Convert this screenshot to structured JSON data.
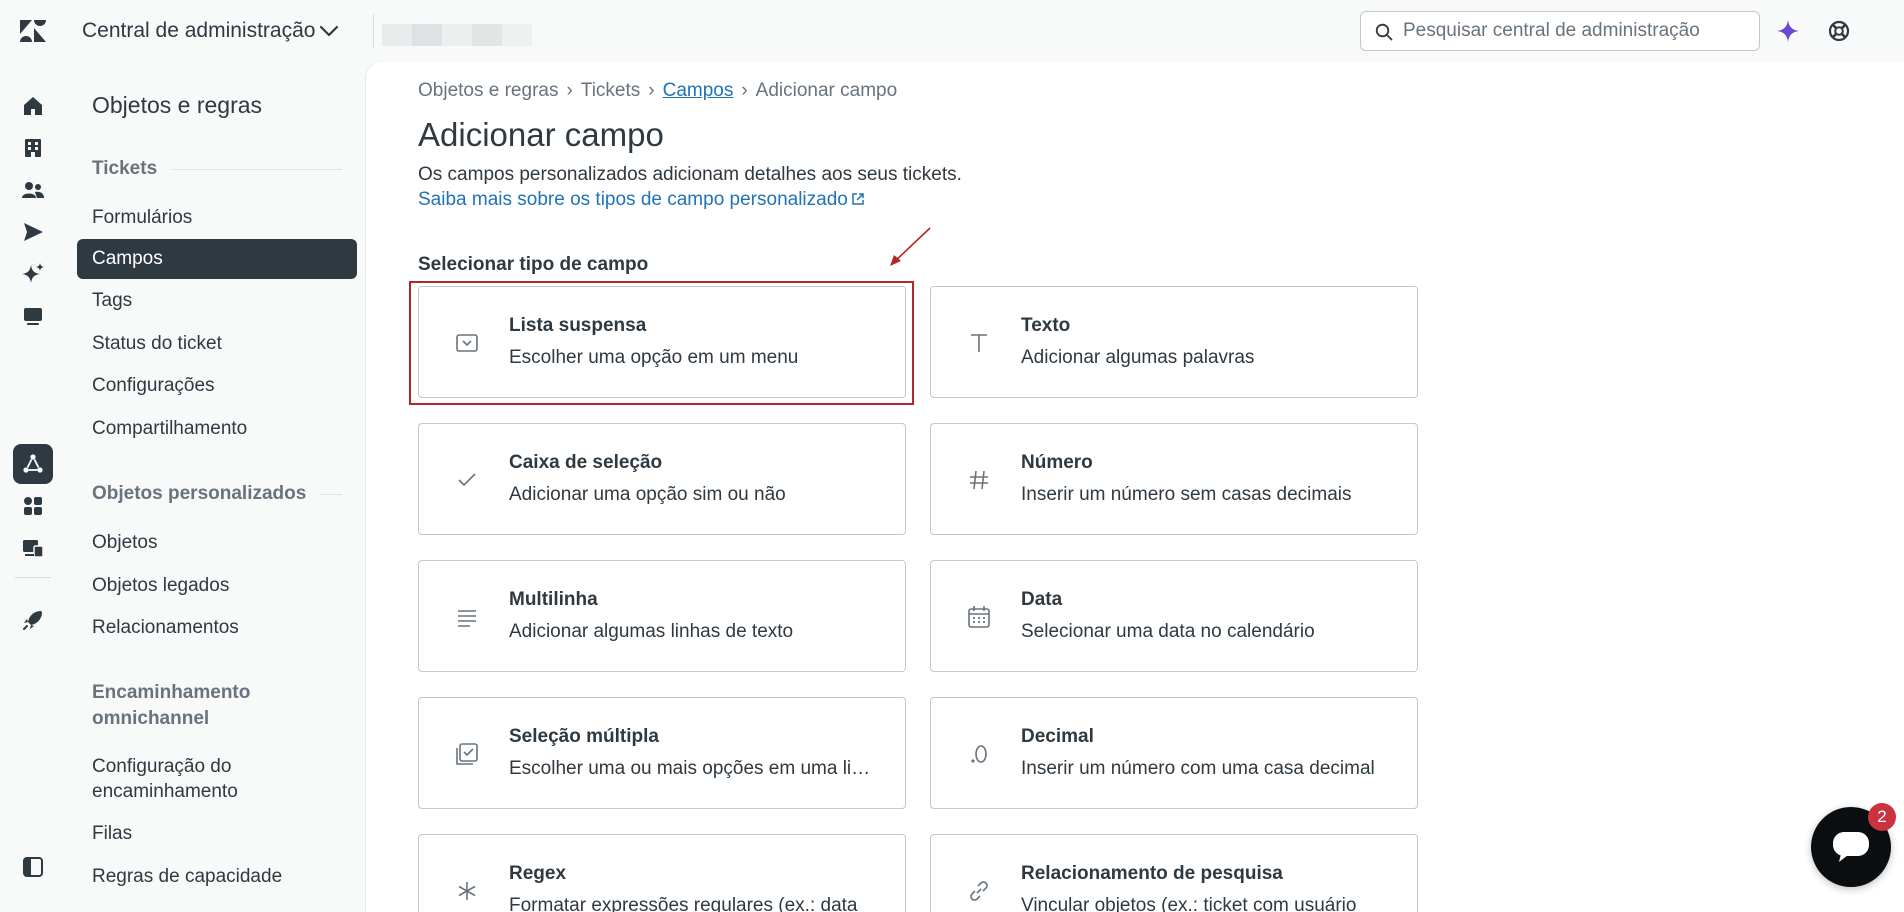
{
  "header": {
    "app_title": "Central de administração",
    "search_placeholder": "Pesquisar central de administração",
    "icons": [
      "zendesk-logo-icon",
      "chevron-down-icon",
      "search-icon",
      "ai-sparkle-icon",
      "help-lifebuoy-icon"
    ]
  },
  "rail": {
    "icons": [
      "home-icon",
      "building-icon",
      "people-icon",
      "send-icon",
      "sparkle-icon",
      "chat-icon",
      "objects-rules-icon",
      "apps-icon",
      "workspace-icon",
      "rocket-icon",
      "panel-collapse-icon"
    ]
  },
  "subnav": {
    "title": "Objetos e regras",
    "sections": [
      {
        "heading": "Tickets",
        "items": [
          "Formulários",
          "Campos",
          "Tags",
          "Status do ticket",
          "Configurações",
          "Compartilhamento"
        ]
      },
      {
        "heading": "Objetos personalizados",
        "items": [
          "Objetos",
          "Objetos legados",
          "Relacionamentos"
        ]
      },
      {
        "heading": "Encaminhamento omnichannel",
        "items": [
          "Configuração do encaminhamento",
          "Filas",
          "Regras de capacidade"
        ]
      }
    ],
    "active_item": "Campos"
  },
  "main": {
    "breadcrumb": [
      "Objetos e regras",
      "Tickets",
      "Campos",
      "Adicionar campo"
    ],
    "title": "Adicionar campo",
    "description": "Os campos personalizados adicionam detalhes aos seus tickets.",
    "learn_more": "Saiba mais sobre os tipos de campo personalizado",
    "section_label": "Selecionar tipo de campo",
    "field_types": [
      {
        "title": "Lista suspensa",
        "subtitle": "Escolher uma opção em um menu",
        "icon": "dropdown-icon"
      },
      {
        "title": "Texto",
        "subtitle": "Adicionar algumas palavras",
        "icon": "text-icon"
      },
      {
        "title": "Caixa de seleção",
        "subtitle": "Adicionar uma opção sim ou não",
        "icon": "checkmark-icon"
      },
      {
        "title": "Número",
        "subtitle": "Inserir um número sem casas decimais",
        "icon": "hash-icon"
      },
      {
        "title": "Multilinha",
        "subtitle": "Adicionar algumas linhas de texto",
        "icon": "lines-icon"
      },
      {
        "title": "Data",
        "subtitle": "Selecionar uma data no calendário",
        "icon": "calendar-icon"
      },
      {
        "title": "Seleção múltipla",
        "subtitle": "Escolher uma ou mais opções em uma li…",
        "icon": "multiselect-icon"
      },
      {
        "title": "Decimal",
        "subtitle": "Inserir um número com uma casa decimal",
        "icon": "decimal-icon"
      },
      {
        "title": "Regex",
        "subtitle": "Formatar expressões regulares (ex.: data",
        "icon": "asterisk-icon"
      },
      {
        "title": "Relacionamento de pesquisa",
        "subtitle": "Vincular objetos (ex.: ticket com usuário",
        "icon": "link-icon"
      }
    ]
  },
  "chat": {
    "badge_count": "2"
  },
  "colors": {
    "accent_dark": "#2f3941",
    "link": "#1f73b7",
    "highlight": "#b0272a",
    "badge": "#cc3340"
  }
}
